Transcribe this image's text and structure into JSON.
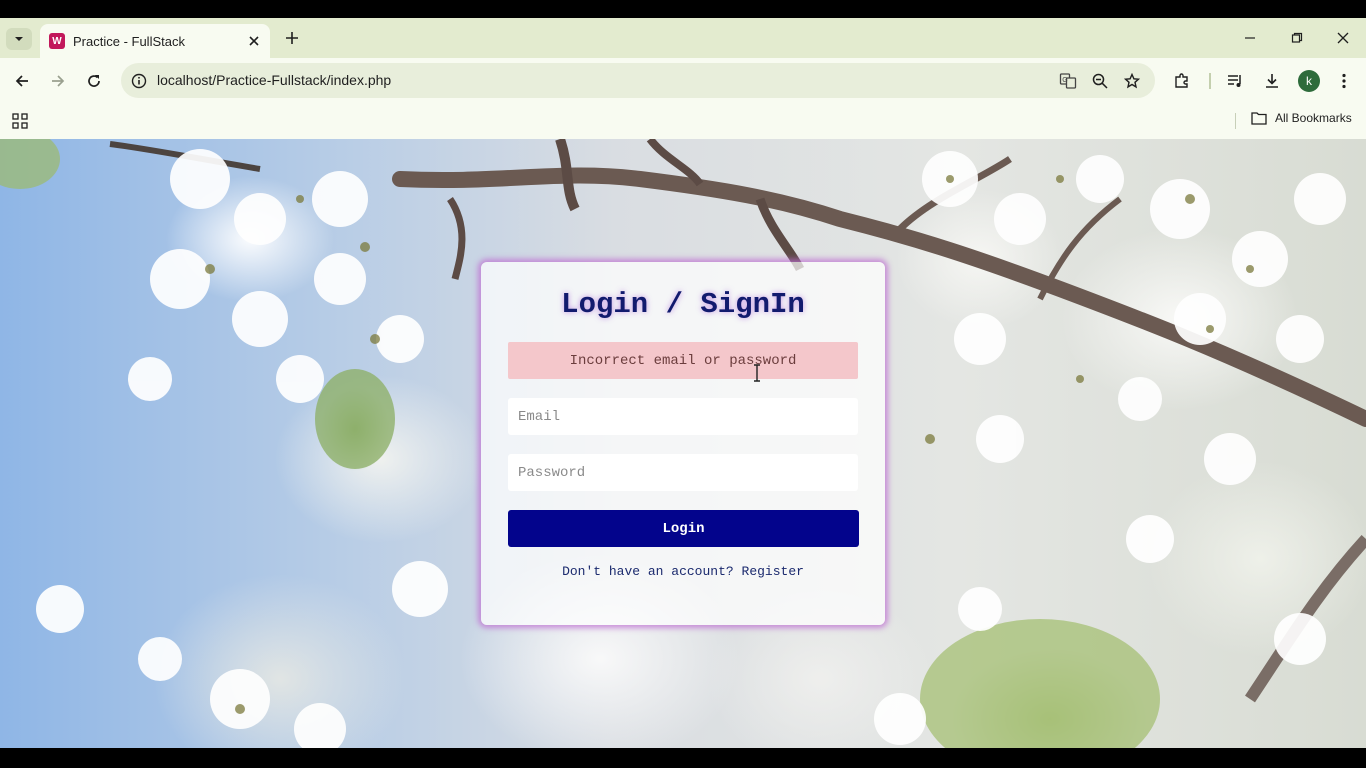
{
  "browser": {
    "tab_title": "Practice - FullStack",
    "favicon_letter": "W",
    "url": "localhost/Practice-Fullstack/index.php",
    "profile_initial": "k",
    "bookmarks_label": "All Bookmarks"
  },
  "login": {
    "title": "Login / SignIn",
    "error_message": "Incorrect email or password",
    "email_placeholder": "Email",
    "password_placeholder": "Password",
    "submit_label": "Login",
    "register_prompt": "Don't have an account?",
    "register_link": "Register"
  },
  "colors": {
    "button": "#03048c",
    "title": "#121b6e",
    "error_bg": "#f4c7cb",
    "card_glow": "#be6ed2"
  }
}
